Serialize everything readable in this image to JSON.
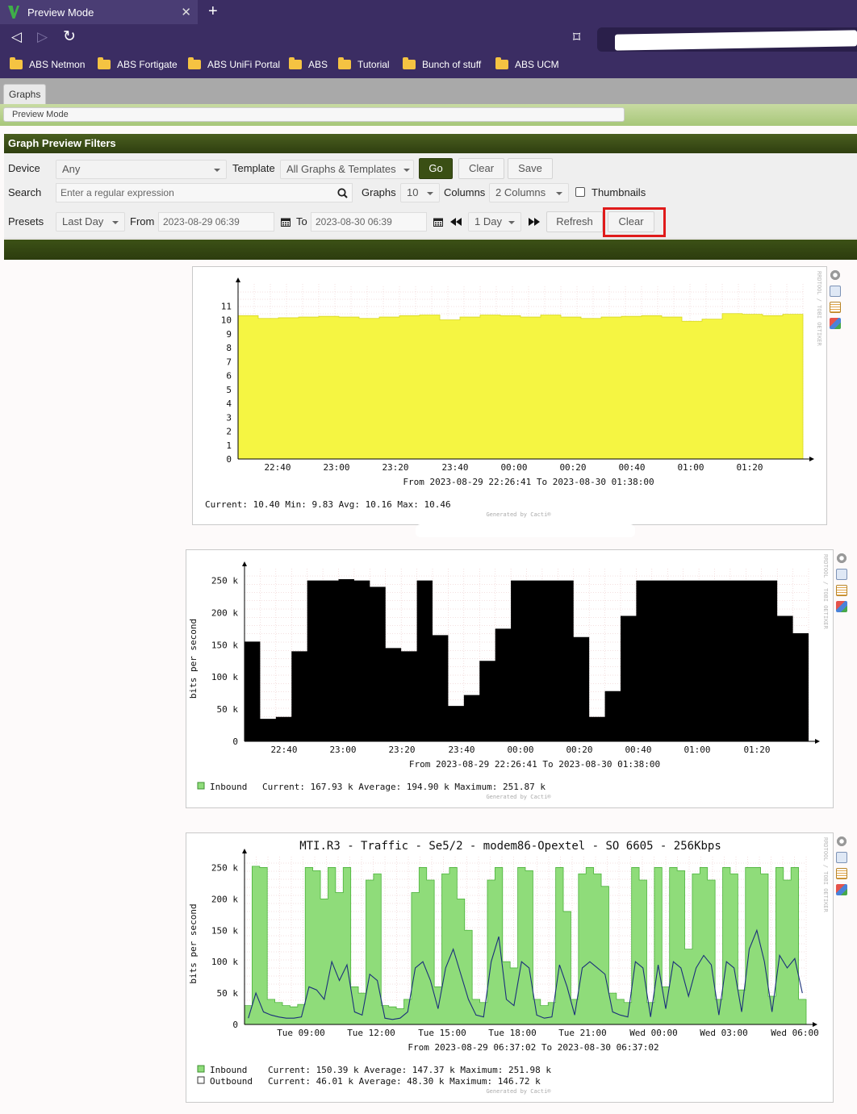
{
  "browser": {
    "tab_title": "Preview Mode",
    "close_glyph": "✕",
    "newtab_glyph": "+",
    "back_glyph": "◁",
    "forward_glyph": "▷",
    "reload_glyph": "↻",
    "bookmark_glyph": "⌑",
    "bookmarks": [
      "ABS Netmon",
      "ABS Fortigate",
      "ABS UniFi Portal",
      "ABS",
      "Tutorial",
      "Bunch of stuff",
      "ABS UCM"
    ]
  },
  "app": {
    "tab_label": "Graphs",
    "breadcrumb": "Preview Mode"
  },
  "filters": {
    "title": "Graph Preview Filters",
    "device_label": "Device",
    "device_value": "Any",
    "template_label": "Template",
    "template_value": "All Graphs & Templates",
    "go": "Go",
    "clear": "Clear",
    "save": "Save",
    "search_label": "Search",
    "search_placeholder": "Enter a regular expression",
    "graphs_label": "Graphs",
    "graphs_value": "10",
    "columns_label": "Columns",
    "columns_value": "2 Columns",
    "thumbnails_label": "Thumbnails",
    "presets_label": "Presets",
    "presets_value": "Last Day",
    "from_label": "From",
    "from_value": "2023-08-29 06:39",
    "to_label": "To",
    "to_value": "2023-08-30 06:39",
    "span_value": "1 Day",
    "refresh": "Refresh",
    "clear2": "Clear"
  },
  "colors": {
    "accent": "#3a4f14",
    "highlight": "#e01b1b",
    "yellow": "#f5f542",
    "green": "#8fdc7a",
    "outbound": "#1a2f7a"
  },
  "chart_data": [
    {
      "type": "area",
      "title": "",
      "ylabel": "",
      "ylim": [
        0,
        11.5
      ],
      "yticks": [
        0,
        1,
        2,
        3,
        4,
        5,
        6,
        7,
        8,
        9,
        10,
        11
      ],
      "xticks": [
        "22:40",
        "23:00",
        "23:20",
        "23:40",
        "00:00",
        "00:20",
        "00:40",
        "01:00",
        "01:20"
      ],
      "period": "From 2023-08-29 22:26:41 To 2023-08-30 01:38:00",
      "values": [
        10.3,
        10.1,
        10.15,
        10.2,
        10.25,
        10.2,
        10.1,
        10.2,
        10.3,
        10.35,
        10.0,
        10.2,
        10.35,
        10.3,
        10.2,
        10.35,
        10.2,
        10.1,
        10.2,
        10.25,
        10.3,
        10.2,
        9.9,
        10.05,
        10.45,
        10.4,
        10.3,
        10.4
      ],
      "legend": {
        "row": "Current:   10.40    Min:     9.83    Avg:   10.16     Max:   10.46"
      },
      "generated": "Generated by Cacti®"
    },
    {
      "type": "area",
      "title": "",
      "ylabel": "bits per second",
      "ylim": [
        0,
        260
      ],
      "yticks": [
        "0",
        "50 k",
        "100 k",
        "150 k",
        "200 k",
        "250 k"
      ],
      "xticks": [
        "22:40",
        "23:00",
        "23:20",
        "23:40",
        "00:00",
        "00:20",
        "00:40",
        "01:00",
        "01:20"
      ],
      "period": "From 2023-08-29 22:26:41 To 2023-08-30 01:38:00",
      "values": [
        155,
        35,
        38,
        140,
        250,
        250,
        252,
        250,
        240,
        145,
        140,
        250,
        165,
        55,
        72,
        125,
        175,
        250,
        250,
        250,
        250,
        162,
        38,
        78,
        195,
        250,
        250,
        250,
        250,
        250,
        250,
        250,
        250,
        250,
        195,
        168
      ],
      "legend": {
        "name": "Inbound",
        "stats": "Current:   167.93 k   Average:   194.90 k   Maximum:    251.87 k"
      },
      "generated": "Generated by Cacti®"
    },
    {
      "type": "area",
      "title": "MTI.R3 - Traffic - Se5/2 - modem86-Opextel - SO 6605 - 256Kbps",
      "ylabel": "bits per second",
      "ylim": [
        0,
        260
      ],
      "yticks": [
        "0",
        "50 k",
        "100 k",
        "150 k",
        "200 k",
        "250 k"
      ],
      "xticks": [
        "Tue 09:00",
        "Tue 12:00",
        "Tue 15:00",
        "Tue 18:00",
        "Tue 21:00",
        "Wed 00:00",
        "Wed 03:00",
        "Wed 06:00"
      ],
      "period": "From 2023-08-29 06:37:02 To 2023-08-30 06:37:02",
      "series": [
        {
          "name": "Inbound",
          "values": [
            30,
            252,
            250,
            40,
            35,
            30,
            28,
            32,
            250,
            245,
            200,
            250,
            210,
            250,
            60,
            50,
            230,
            240,
            30,
            28,
            25,
            40,
            210,
            250,
            230,
            60,
            240,
            250,
            200,
            150,
            40,
            35,
            230,
            250,
            100,
            90,
            250,
            245,
            40,
            30,
            35,
            250,
            180,
            40,
            240,
            250,
            240,
            220,
            50,
            40,
            35,
            250,
            230,
            35,
            250,
            60,
            250,
            245,
            120,
            240,
            250,
            230,
            40,
            250,
            240,
            55,
            250,
            250,
            240,
            45,
            250,
            230,
            250,
            40
          ],
          "stats": "Current:   150.39 k   Average:   147.37 k   Maximum:   251.98 k"
        },
        {
          "name": "Outbound",
          "values": [
            10,
            50,
            20,
            15,
            12,
            10,
            10,
            12,
            60,
            55,
            40,
            100,
            70,
            95,
            20,
            15,
            80,
            70,
            10,
            8,
            10,
            20,
            90,
            100,
            70,
            25,
            90,
            120,
            80,
            40,
            15,
            12,
            100,
            140,
            40,
            30,
            100,
            90,
            15,
            10,
            12,
            95,
            60,
            15,
            90,
            100,
            90,
            80,
            20,
            15,
            12,
            100,
            90,
            12,
            95,
            25,
            100,
            90,
            45,
            90,
            110,
            95,
            15,
            100,
            90,
            20,
            120,
            150,
            100,
            20,
            110,
            90,
            105,
            50
          ],
          "stats": "Current:    46.01 k   Average:    48.30 k   Maximum:   146.72 k"
        }
      ],
      "generated": "Generated by Cacti®"
    }
  ]
}
